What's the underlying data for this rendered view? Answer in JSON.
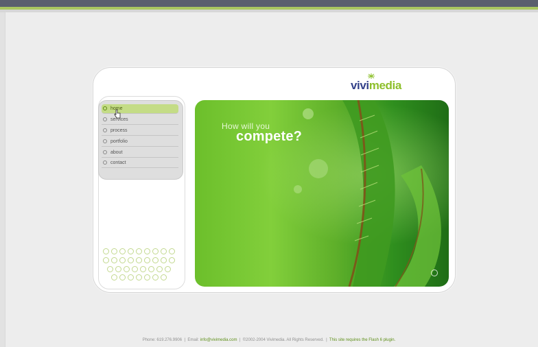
{
  "brand": {
    "logo_part1": "vivi",
    "logo_part2": "media"
  },
  "menu": {
    "items": [
      {
        "label": "home",
        "active": true
      },
      {
        "label": "services"
      },
      {
        "label": "process"
      },
      {
        "label": "portfolio"
      },
      {
        "label": "about"
      },
      {
        "label": "contact"
      }
    ]
  },
  "hero": {
    "line1": "How will you",
    "line2": "compete?"
  },
  "footer": {
    "phone": "Phone: 619.276.9906",
    "email_label": "Email:",
    "email": "info@vivimedia.com",
    "copyright": "©2002-2004 Vivimedia. All Rights Reserved.",
    "flash_note": "This site requires the Flash 6 plugin."
  },
  "colors": {
    "accent_green": "#8dbf2a",
    "brand_blue": "#34428a",
    "top_bar": "#5a5f6e"
  }
}
